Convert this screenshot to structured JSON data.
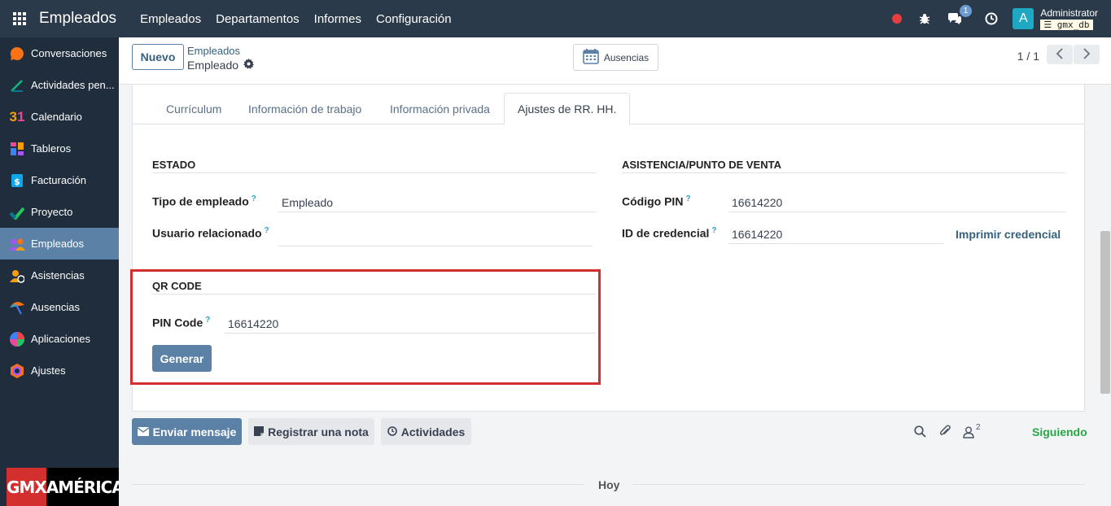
{
  "topbar": {
    "app_title": "Empleados",
    "menu": [
      "Empleados",
      "Departamentos",
      "Informes",
      "Configuración"
    ],
    "chat_badge": "1",
    "avatar_letter": "A",
    "username": "Administrator",
    "database": "gmx_db"
  },
  "sidebar": {
    "items": [
      {
        "label": "Conversaciones",
        "icon": "chat-bubble-icon",
        "color": "#f97316"
      },
      {
        "label": "Actividades pen...",
        "icon": "activity-icon",
        "color": "#10b981"
      },
      {
        "label": "Calendario",
        "icon": "calendar-31-icon",
        "color": "#f59e0b"
      },
      {
        "label": "Tableros",
        "icon": "dashboard-icon",
        "color": "#ec4899"
      },
      {
        "label": "Facturación",
        "icon": "invoice-icon",
        "color": "#0ea5e9"
      },
      {
        "label": "Proyecto",
        "icon": "project-icon",
        "color": "#22c55e"
      },
      {
        "label": "Empleados",
        "icon": "employees-icon",
        "color": "#a855f7"
      },
      {
        "label": "Asistencias",
        "icon": "attendance-icon",
        "color": "#f59e0b"
      },
      {
        "label": "Ausencias",
        "icon": "time-off-icon",
        "color": "#f97316"
      },
      {
        "label": "Aplicaciones",
        "icon": "apps-icon",
        "color": "#ef4444"
      },
      {
        "label": "Ajustes",
        "icon": "settings-icon",
        "color": "#f97316"
      }
    ],
    "logo_left": "GMX",
    "logo_right": "AMÉRICA"
  },
  "control": {
    "new_button": "Nuevo",
    "breadcrumb_parent": "Empleados",
    "breadcrumb_current": "Empleado",
    "time_off_button": "Ausencias",
    "pager": "1 / 1"
  },
  "tabs": [
    "Currículum",
    "Información de trabajo",
    "Información privada",
    "Ajustes de RR. HH."
  ],
  "estado": {
    "title": "ESTADO",
    "employee_type_label": "Tipo de empleado",
    "employee_type_value": "Empleado",
    "related_user_label": "Usuario relacionado",
    "related_user_value": ""
  },
  "attendance": {
    "title": "ASISTENCIA/PUNTO DE VENTA",
    "pin_label": "Código PIN",
    "pin_value": "16614220",
    "badge_label": "ID de credencial",
    "badge_value": "16614220",
    "print_badge": "Imprimir credencial"
  },
  "qr": {
    "title": "QR CODE",
    "pin_label": "PIN Code",
    "pin_value": "16614220",
    "generate_button": "Generar"
  },
  "chatter": {
    "send_message": "Enviar mensaje",
    "log_note": "Registrar una nota",
    "activities": "Actividades",
    "followers_count": "2",
    "following": "Siguiendo",
    "today": "Hoy"
  },
  "colors": {
    "navbar": "#2b3a4a",
    "sidebar": "#1f2d3d",
    "sidebar_active": "#5b82a6",
    "primary": "#5b82a6",
    "highlight_box": "#d32f2f",
    "following": "#28a745"
  }
}
